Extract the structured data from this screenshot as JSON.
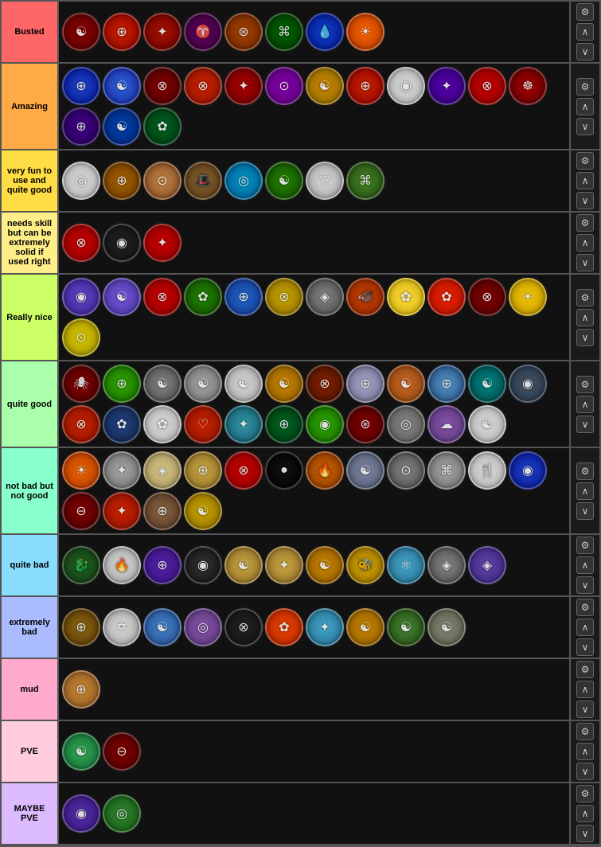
{
  "tiers": [
    {
      "id": "busted",
      "label": "Busted",
      "labelColor": "#ff6666",
      "icons": [
        {
          "color": "#8B0000",
          "border": "#FFD700",
          "symbol": "☯",
          "bg": "radial-gradient(circle, #8B0000, #550000)"
        },
        {
          "color": "#CC0000",
          "border": "#FFD700",
          "symbol": "⊕",
          "bg": "radial-gradient(circle, #CC2200, #880000)"
        },
        {
          "color": "#AA0000",
          "border": "#FFD700",
          "symbol": "✦",
          "bg": "radial-gradient(circle, #AA1100, #660000)"
        },
        {
          "color": "#660066",
          "border": "#ccc",
          "symbol": "♈",
          "bg": "radial-gradient(circle, #660066, #330033)"
        },
        {
          "color": "#AA4400",
          "border": "#FFD700",
          "symbol": "⊛",
          "bg": "radial-gradient(circle, #AA4400, #662200)"
        },
        {
          "color": "#008800",
          "border": "#FFD700",
          "symbol": "⌘",
          "bg": "radial-gradient(circle, #006600, #003300)"
        },
        {
          "color": "#1144CC",
          "border": "#ccc",
          "symbol": "💧",
          "bg": "radial-gradient(circle, #1144CC, #001188)"
        },
        {
          "color": "#FF6600",
          "border": "#FFD700",
          "symbol": "☀",
          "bg": "radial-gradient(circle, #FF6600, #AA3300)"
        }
      ]
    },
    {
      "id": "amazing",
      "label": "Amazing",
      "labelColor": "#ffaa44",
      "icons": [
        {
          "bg": "radial-gradient(circle, #2244cc, #001188)",
          "symbol": "⊕"
        },
        {
          "bg": "radial-gradient(circle, #3366dd, #112299)",
          "symbol": "☯"
        },
        {
          "bg": "radial-gradient(circle, #880000, #440000)",
          "symbol": "⊗"
        },
        {
          "bg": "radial-gradient(circle, #cc2200, #881100)",
          "symbol": "⊗"
        },
        {
          "bg": "radial-gradient(circle, #aa0000, #660000)",
          "symbol": "✦"
        },
        {
          "bg": "radial-gradient(circle, #8800aa, #550077)",
          "symbol": "⊙"
        },
        {
          "bg": "radial-gradient(circle, #cc8800, #886600)",
          "symbol": "☯"
        },
        {
          "bg": "radial-gradient(circle, #cc2200, #880000)",
          "symbol": "⊕"
        },
        {
          "bg": "radial-gradient(circle, #dddddd, #aaaaaa)",
          "symbol": "◉"
        },
        {
          "bg": "radial-gradient(circle, #5500aa, #330077)",
          "symbol": "✦"
        },
        {
          "bg": "radial-gradient(circle, #cc0000, #880000)",
          "symbol": "⊗"
        },
        {
          "bg": "radial-gradient(circle, #aa0000, #550000)",
          "symbol": "☸"
        },
        {
          "bg": "radial-gradient(circle, #440088, #220055)",
          "symbol": "⊕"
        },
        {
          "bg": "radial-gradient(circle, #0044aa, #002277)",
          "symbol": "☯"
        },
        {
          "bg": "radial-gradient(circle, #006622, #003311)",
          "symbol": "✿"
        }
      ]
    },
    {
      "id": "very-fun",
      "label": "very fun to use and quite good",
      "labelColor": "#ffdd44",
      "icons": [
        {
          "bg": "radial-gradient(circle, #dddddd, #aaaaaa)",
          "symbol": "◎"
        },
        {
          "bg": "radial-gradient(circle, #aa6600, #663300)",
          "symbol": "⊕"
        },
        {
          "bg": "radial-gradient(circle, #cc8844, #774422)",
          "symbol": "⊙"
        },
        {
          "bg": "radial-gradient(circle, #886633, #553311)",
          "symbol": "🎩"
        },
        {
          "bg": "radial-gradient(circle, #0099cc, #005588)",
          "symbol": "◎"
        },
        {
          "bg": "radial-gradient(circle, #228800, #114400)",
          "symbol": "☯"
        },
        {
          "bg": "radial-gradient(circle, #dddddd, #999999)",
          "symbol": "▽"
        },
        {
          "bg": "radial-gradient(circle, #448822, #224411)",
          "symbol": "⌘"
        }
      ]
    },
    {
      "id": "needs-skill",
      "label": "needs skill but can be extremely solid if used right",
      "labelColor": "#ffee88",
      "icons": [
        {
          "bg": "radial-gradient(circle, #cc0000, #880000)",
          "symbol": "⊗"
        },
        {
          "bg": "radial-gradient(circle, #222222, #111111)",
          "symbol": "◉"
        },
        {
          "bg": "radial-gradient(circle, #cc0000, #880000)",
          "symbol": "✦"
        }
      ]
    },
    {
      "id": "really-nice",
      "label": "Really nice",
      "labelColor": "#ccff66",
      "icons": [
        {
          "bg": "radial-gradient(circle, #6644cc, #332288)",
          "symbol": "◉"
        },
        {
          "bg": "radial-gradient(circle, #7755dd, #443399)",
          "symbol": "☯"
        },
        {
          "bg": "radial-gradient(circle, #cc0000, #880000)",
          "symbol": "⊗"
        },
        {
          "bg": "radial-gradient(circle, #228800, #114400)",
          "symbol": "✿"
        },
        {
          "bg": "radial-gradient(circle, #2266cc, #113388)",
          "symbol": "⊕"
        },
        {
          "bg": "radial-gradient(circle, #ccaa00, #886600)",
          "symbol": "⊛"
        },
        {
          "bg": "radial-gradient(circle, #888888, #444444)",
          "symbol": "◈"
        },
        {
          "bg": "radial-gradient(circle, #cc4400, #882200)",
          "symbol": "🐗"
        },
        {
          "bg": "radial-gradient(circle, #ffdd44, #ccaa00)",
          "symbol": "✿"
        },
        {
          "bg": "radial-gradient(circle, #ee2200, #aa1100)",
          "symbol": "✿"
        },
        {
          "bg": "radial-gradient(circle, #880000, #440000)",
          "symbol": "⊗"
        },
        {
          "bg": "radial-gradient(circle, #ffcc00, #aa8800)",
          "symbol": "☀"
        },
        {
          "bg": "radial-gradient(circle, #ddcc00, #998800)",
          "symbol": "⊙"
        }
      ]
    },
    {
      "id": "quite-good",
      "label": "quite good",
      "labelColor": "#aaffaa",
      "icons": [
        {
          "bg": "radial-gradient(circle, #880000, #440000)",
          "symbol": "🕷"
        },
        {
          "bg": "radial-gradient(circle, #33aa00, #116600)",
          "symbol": "⊕"
        },
        {
          "bg": "radial-gradient(circle, #888888, #444444)",
          "symbol": "☯"
        },
        {
          "bg": "radial-gradient(circle, #aaaaaa, #666666)",
          "symbol": "☯"
        },
        {
          "bg": "radial-gradient(circle, #dddddd, #999999)",
          "symbol": "☯"
        },
        {
          "bg": "radial-gradient(circle, #cc8800, #885500)",
          "symbol": "☯"
        },
        {
          "bg": "radial-gradient(circle, #882200, #441100)",
          "symbol": "⊗"
        },
        {
          "bg": "radial-gradient(circle, #aaaacc, #666688)",
          "symbol": "⊕"
        },
        {
          "bg": "radial-gradient(circle, #cc6622, #884411)",
          "symbol": "☯"
        },
        {
          "bg": "radial-gradient(circle, #5599cc, #224477)",
          "symbol": "⊕"
        },
        {
          "bg": "radial-gradient(circle, #008888, #004444)",
          "symbol": "☯"
        },
        {
          "bg": "radial-gradient(circle, #445566, #223344)",
          "symbol": "◉"
        },
        {
          "bg": "radial-gradient(circle, #cc2200, #881100)",
          "symbol": "⊗"
        },
        {
          "bg": "radial-gradient(circle, #224488, #112244)",
          "symbol": "✿"
        },
        {
          "bg": "radial-gradient(circle, #dddddd, #aaaaaa)",
          "symbol": "✿"
        },
        {
          "bg": "radial-gradient(circle, #cc2200, #881100)",
          "symbol": "♡"
        },
        {
          "bg": "radial-gradient(circle, #3399aa, #115566)",
          "symbol": "✦"
        },
        {
          "bg": "radial-gradient(circle, #006622, #003311)",
          "symbol": "⊕"
        },
        {
          "bg": "radial-gradient(circle, #33aa00, #116600)",
          "symbol": "◉"
        },
        {
          "bg": "radial-gradient(circle, #880000, #440000)",
          "symbol": "⊛"
        },
        {
          "bg": "radial-gradient(circle, #888888, #555555)",
          "symbol": "◎"
        },
        {
          "bg": "radial-gradient(circle, #8855aa, #553377)",
          "symbol": "☁"
        },
        {
          "bg": "radial-gradient(circle, #dddddd, #aaaaaa)",
          "symbol": "☯"
        }
      ]
    },
    {
      "id": "not-bad",
      "label": "not bad but not good",
      "labelColor": "#88ffcc",
      "icons": [
        {
          "bg": "radial-gradient(circle, #ee6600, #aa3300)",
          "symbol": "☀"
        },
        {
          "bg": "radial-gradient(circle, #aaaaaa, #666666)",
          "symbol": "✦"
        },
        {
          "bg": "radial-gradient(circle, #ddcc88, #998855)",
          "symbol": "◈"
        },
        {
          "bg": "radial-gradient(circle, #ccaa44, #886622)",
          "symbol": "⊕"
        },
        {
          "bg": "radial-gradient(circle, #cc0000, #880000)",
          "symbol": "⊗"
        },
        {
          "bg": "radial-gradient(circle, #111111, #000000)",
          "symbol": "●"
        },
        {
          "bg": "radial-gradient(circle, #cc6600, #883300)",
          "symbol": "🔥"
        },
        {
          "bg": "radial-gradient(circle, #8888aa, #445566)",
          "symbol": "☯"
        },
        {
          "bg": "radial-gradient(circle, #888888, #444444)",
          "symbol": "⊙"
        },
        {
          "bg": "radial-gradient(circle, #aaaaaa, #666666)",
          "symbol": "⌘"
        },
        {
          "bg": "radial-gradient(circle, #dddddd, #aaaaaa)",
          "symbol": "🍴"
        },
        {
          "bg": "radial-gradient(circle, #2244cc, #001188)",
          "symbol": "◉"
        },
        {
          "bg": "radial-gradient(circle, #880000, #440000)",
          "symbol": "⊖"
        },
        {
          "bg": "radial-gradient(circle, #cc2200, #881100)",
          "symbol": "✦"
        },
        {
          "bg": "radial-gradient(circle, #886644, #553322)",
          "symbol": "⊕"
        },
        {
          "bg": "radial-gradient(circle, #ccaa00, #886600)",
          "symbol": "☯"
        }
      ]
    },
    {
      "id": "quite-bad",
      "label": "quite bad",
      "labelColor": "#88ddff",
      "icons": [
        {
          "bg": "radial-gradient(circle, #226622, #113311)",
          "symbol": "🐉"
        },
        {
          "bg": "radial-gradient(circle, #dddddd, #999999)",
          "symbol": "🔥"
        },
        {
          "bg": "radial-gradient(circle, #5522aa, #331177)",
          "symbol": "⊕"
        },
        {
          "bg": "radial-gradient(circle, #333333, #111111)",
          "symbol": "◉"
        },
        {
          "bg": "radial-gradient(circle, #ccaa44, #886622)",
          "symbol": "☯"
        },
        {
          "bg": "radial-gradient(circle, #ccaa44, #886622)",
          "symbol": "✦"
        },
        {
          "bg": "radial-gradient(circle, #cc8800, #885500)",
          "symbol": "☯"
        },
        {
          "bg": "radial-gradient(circle, #ddaa00, #886600)",
          "symbol": "🐝"
        },
        {
          "bg": "radial-gradient(circle, #44aacc, #226688)",
          "symbol": "⚛"
        },
        {
          "bg": "radial-gradient(circle, #888888, #444444)",
          "symbol": "◈"
        },
        {
          "bg": "radial-gradient(circle, #6644aa, #332277)",
          "symbol": "◈"
        }
      ]
    },
    {
      "id": "extremely-bad",
      "label": "extremely bad",
      "labelColor": "#aabbff",
      "icons": [
        {
          "bg": "radial-gradient(circle, #8B6914, #553300)",
          "symbol": "⊕"
        },
        {
          "bg": "radial-gradient(circle, #dddddd, #999999)",
          "symbol": "✡"
        },
        {
          "bg": "radial-gradient(circle, #4488cc, #224488)",
          "symbol": "☯"
        },
        {
          "bg": "radial-gradient(circle, #8855aa, #553377)",
          "symbol": "◎"
        },
        {
          "bg": "radial-gradient(circle, #222222, #111111)",
          "symbol": "⊗"
        },
        {
          "bg": "radial-gradient(circle, #ee4400, #aa2200)",
          "symbol": "✿"
        },
        {
          "bg": "radial-gradient(circle, #44aacc, #226688)",
          "symbol": "✦"
        },
        {
          "bg": "radial-gradient(circle, #cc8800, #885500)",
          "symbol": "☯"
        },
        {
          "bg": "radial-gradient(circle, #448833, #224411)",
          "symbol": "☯"
        },
        {
          "bg": "radial-gradient(circle, #888877, #555544)",
          "symbol": "☯"
        }
      ]
    },
    {
      "id": "mud",
      "label": "mud",
      "labelColor": "#ffaacc",
      "icons": [
        {
          "bg": "radial-gradient(circle, #cc8833, #885522)",
          "symbol": "⊕"
        }
      ]
    },
    {
      "id": "pve",
      "label": "PVE",
      "labelColor": "#ffccdd",
      "icons": [
        {
          "bg": "radial-gradient(circle, #33aa55, #116633)",
          "symbol": "☯"
        },
        {
          "bg": "radial-gradient(circle, #880000, #440000)",
          "symbol": "⊖"
        }
      ]
    },
    {
      "id": "maybe-pve",
      "label": "MAYBE PVE",
      "labelColor": "#ddbbff",
      "icons": [
        {
          "bg": "radial-gradient(circle, #5533aa, #331177)",
          "symbol": "◉"
        },
        {
          "bg": "radial-gradient(circle, #338833, #115511)",
          "symbol": "◎"
        }
      ]
    }
  ],
  "controls": {
    "gear": "⚙",
    "up": "∧",
    "down": "∨"
  }
}
